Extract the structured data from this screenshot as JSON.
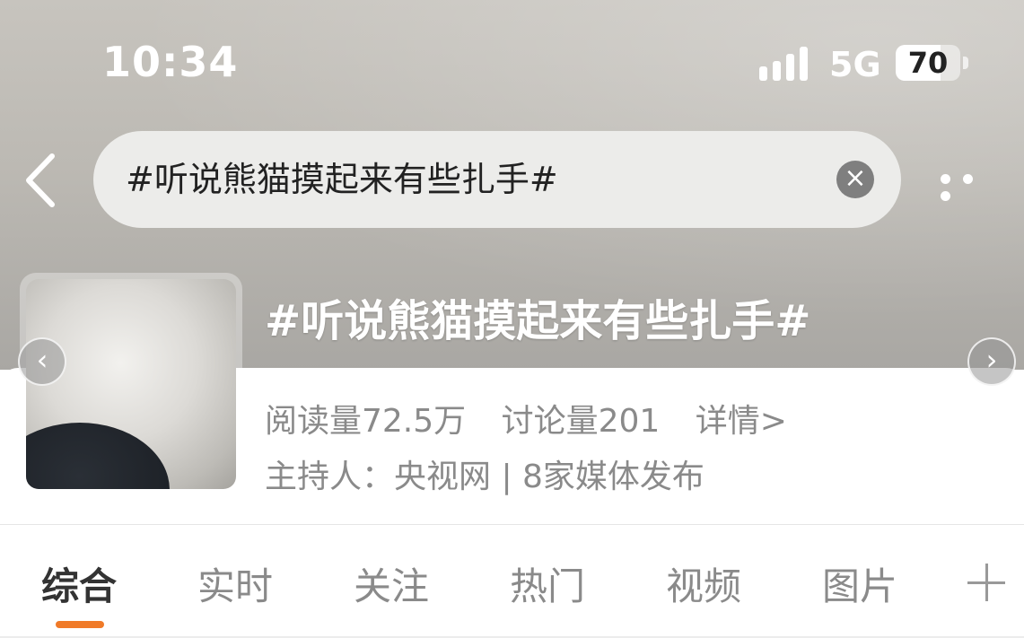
{
  "status_bar": {
    "time": "10:34",
    "network": "5G",
    "battery_level": "70",
    "battery_fraction": 0.7
  },
  "search": {
    "query": "#听说熊猫摸起来有些扎手#",
    "clear_glyph": "×"
  },
  "topic": {
    "title": "#听说熊猫摸起来有些扎手#",
    "reads": "阅读量72.5万",
    "discussions": "讨论量201",
    "details": "详情>",
    "host": "主持人：央视网 | 8家媒体发布"
  },
  "carousel": {
    "prev_glyph": "‹",
    "next_glyph": "›"
  },
  "tabs": [
    {
      "label": "综合",
      "active": true
    },
    {
      "label": "实时",
      "active": false
    },
    {
      "label": "关注",
      "active": false
    },
    {
      "label": "热门",
      "active": false
    },
    {
      "label": "视频",
      "active": false
    },
    {
      "label": "图片",
      "active": false
    }
  ],
  "icons": [
    "back-chevron-icon",
    "clear-icon",
    "more-icon",
    "signal-icon",
    "battery-icon",
    "plus-icon"
  ],
  "colors": {
    "accent": "#f07a28",
    "muted_text": "#8a8a8a",
    "primary_text": "#333333"
  }
}
